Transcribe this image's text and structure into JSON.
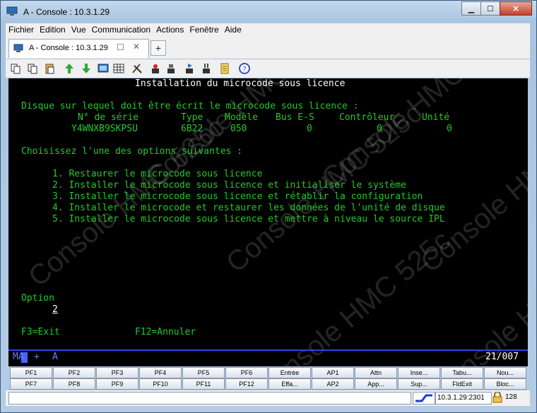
{
  "window": {
    "title": "A - Console : 10.3.1.29"
  },
  "menu": [
    "Fichier",
    "Edition",
    "Vue",
    "Communication",
    "Actions",
    "Fenêtre",
    "Aide"
  ],
  "tab": {
    "label": "A - Console : 10.3.1.29",
    "new_tab": "+"
  },
  "toolbar_icons": [
    "copy-icon",
    "cut-icon",
    "paste-icon",
    "send-icon",
    "receive-icon",
    "display-icon",
    "table-icon",
    "macro-icon",
    "record-icon",
    "stop-icon",
    "play-icon",
    "pause-icon",
    "notes-icon",
    "help-icon"
  ],
  "screen": {
    "title": "Installation du microcode sous licence",
    "question": "Disque sur lequel doit être écrit le microcode sous licence :",
    "headers": [
      "N° de série",
      "Type",
      "Modèle",
      "Bus E-S",
      "Contrôleur",
      "Unité"
    ],
    "values": [
      "Y4WNXB9SKPSU",
      "6B22",
      "050",
      "0",
      "0",
      "0"
    ],
    "choose": "Choisissez l'une des options suivantes :",
    "options": [
      "1. Restaurer le microcode sous licence",
      "2. Installer le microcode sous licence et initialiser le système",
      "3. Installer le microcode sous licence et rétablir la configuration",
      "4. Installer le microcode et restaurer les données de l'unité de disque",
      "5. Installer le microcode sous licence et mettre à niveau le source IPL"
    ],
    "option_label": "Option",
    "option_value": "2",
    "f3": "F3=Exit",
    "f12": "F12=Annuler",
    "status_left_a": "MA",
    "status_left_b": "+",
    "status_mode": "A",
    "status_pos": "21/007",
    "watermark": "Console HMC 525c"
  },
  "pf_row1": [
    "PF1",
    "PF2",
    "PF3",
    "PF4",
    "PF5",
    "PF6",
    "Entrée",
    "AP1",
    "Attn",
    "Inse...",
    "Tabu...",
    "Nou..."
  ],
  "pf_row2": [
    "PF7",
    "PF8",
    "PF9",
    "PF10",
    "PF11",
    "PF12",
    "Effa...",
    "AP2",
    "App...",
    "Sup...",
    "FldExit",
    "Bloc..."
  ],
  "statusbar": {
    "host": "10.3.1.29:2301",
    "bits": "128"
  },
  "colors": {
    "screen_text": "#22c92a",
    "screen_bg": "#000000",
    "status_line": "#2e3ff0"
  }
}
